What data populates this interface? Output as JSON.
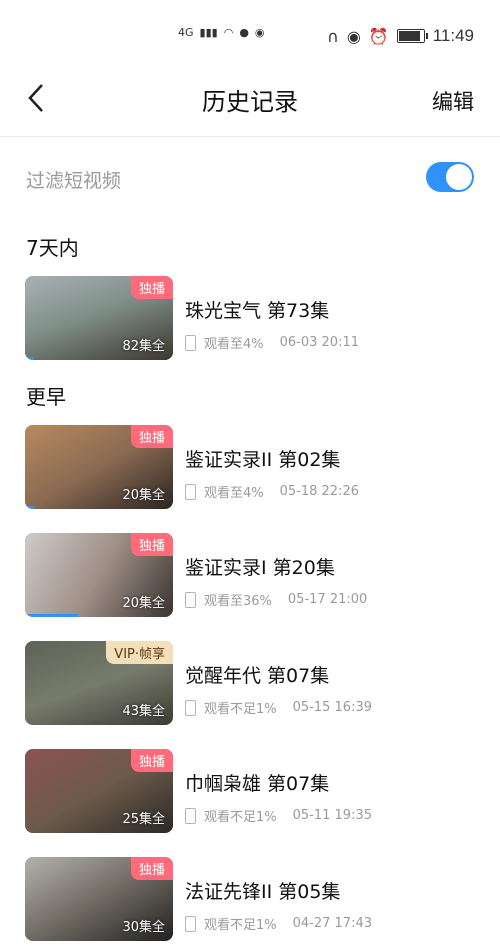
{
  "statusbar": {
    "network": "4G",
    "time": "11:49"
  },
  "header": {
    "title": "历史记录",
    "edit_label": "编辑",
    "back_icon": "chevron-left-icon"
  },
  "filter": {
    "label": "过滤短视频",
    "enabled": true,
    "toggle_color": "#2f92ff"
  },
  "sections": {
    "recent": "7天内",
    "earlier": "更早"
  },
  "items": [
    {
      "title": "珠光宝气 第73集",
      "badge": "独播",
      "episodes": "82集全",
      "progress": "观看至4%",
      "time": "06-03 20:11",
      "progress_fraction": 0.04
    },
    {
      "title": "鉴证实录II 第02集",
      "badge": "独播",
      "episodes": "20集全",
      "progress": "观看至4%",
      "time": "05-18 22:26",
      "progress_fraction": 0.04
    },
    {
      "title": "鉴证实录I 第20集",
      "badge": "独播",
      "episodes": "20集全",
      "progress": "观看至36%",
      "time": "05-17 21:00",
      "progress_fraction": 0.36
    },
    {
      "title": "觉醒年代 第07集",
      "badge": "VIP·帧享",
      "episodes": "43集全",
      "progress": "观看不足1%",
      "time": "05-15 16:39",
      "progress_fraction": 0.0
    },
    {
      "title": "巾帼枭雄 第07集",
      "badge": "独播",
      "episodes": "25集全",
      "progress": "观看不足1%",
      "time": "05-11 19:35",
      "progress_fraction": 0.0
    },
    {
      "title": "法证先锋II 第05集",
      "badge": "独播",
      "episodes": "30集全",
      "progress": "观看不足1%",
      "time": "04-27 17:43",
      "progress_fraction": 0.0
    }
  ],
  "colors": {
    "accent": "#2f92ff",
    "badge": "#ff6b7a",
    "vip_badge": "#f3dfb9"
  }
}
